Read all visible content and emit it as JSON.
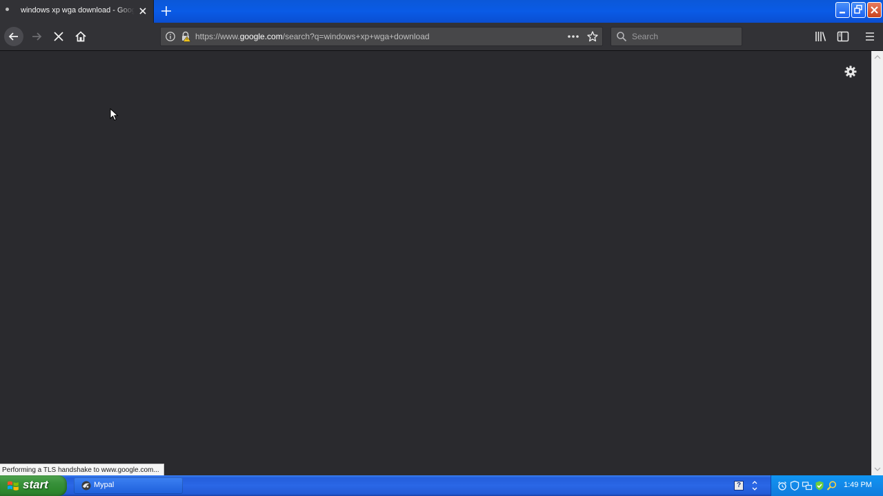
{
  "browser": {
    "tab": {
      "title": "windows xp wga download - Google Search"
    },
    "url": {
      "prefix": "https://www.",
      "host": "google.com",
      "path": "/search?q=windows+xp+wga+download"
    },
    "search": {
      "placeholder": "Search"
    },
    "status_text": "Performing a TLS handshake to www.google.com..."
  },
  "taskbar": {
    "start_label": "start",
    "task_label": "Mypal",
    "clock": "1:49 PM"
  },
  "colors": {
    "page_background": "#2a2a2e",
    "toolbar_background": "#323236",
    "taskbar_blue": "#245edb",
    "start_green": "#37903a"
  }
}
